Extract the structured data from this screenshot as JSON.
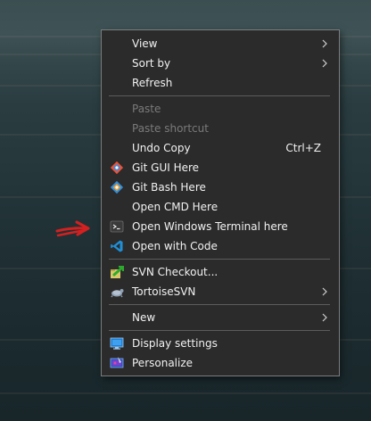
{
  "context_menu": {
    "items": [
      {
        "label": "View",
        "submenu": true
      },
      {
        "label": "Sort by",
        "submenu": true
      },
      {
        "label": "Refresh"
      },
      {
        "label": "Paste",
        "disabled": true
      },
      {
        "label": "Paste shortcut",
        "disabled": true
      },
      {
        "label": "Undo Copy",
        "shortcut": "Ctrl+Z"
      },
      {
        "label": "Git GUI Here",
        "icon": "git-gui-icon"
      },
      {
        "label": "Git Bash Here",
        "icon": "git-bash-icon"
      },
      {
        "label": "Open CMD Here"
      },
      {
        "label": "Open Windows Terminal here",
        "icon": "terminal-icon"
      },
      {
        "label": "Open with Code",
        "icon": "vscode-icon"
      },
      {
        "label": "SVN Checkout...",
        "icon": "svn-checkout-icon"
      },
      {
        "label": "TortoiseSVN",
        "icon": "tortoisesvn-icon",
        "submenu": true
      },
      {
        "label": "New",
        "submenu": true
      },
      {
        "label": "Display settings",
        "icon": "display-settings-icon"
      },
      {
        "label": "Personalize",
        "icon": "personalize-icon"
      }
    ]
  },
  "colors": {
    "menu_bg": "#2b2b2b",
    "text": "#f2f2f2",
    "disabled_text": "#7a7a7a",
    "annotation_arrow": "#d42020"
  }
}
